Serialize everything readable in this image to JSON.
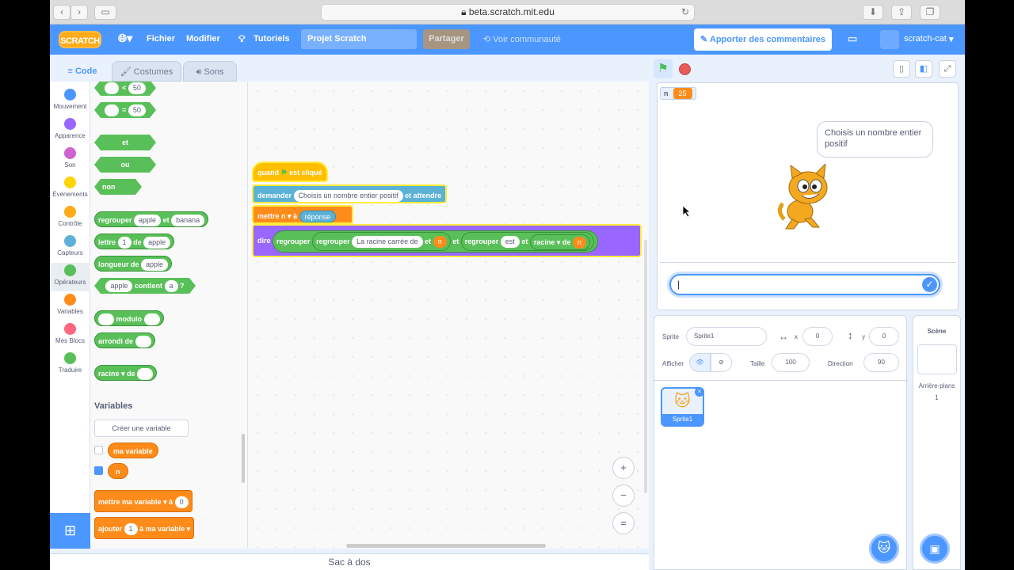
{
  "browser": {
    "url": "beta.scratch.mit.edu",
    "back": "‹",
    "forward": "›"
  },
  "menu": {
    "logo": "SCRATCH",
    "file": "Fichier",
    "edit": "Modifier",
    "tutorials": "Tutoriels",
    "project_title": "Projet Scratch",
    "share": "Partager",
    "see_community": "Voir communauté",
    "comments": "Apporter des commentaires",
    "username": "scratch-cat"
  },
  "tabs": {
    "code": "Code",
    "costumes": "Costumes",
    "sounds": "Sons"
  },
  "categories": [
    {
      "label": "Mouvement",
      "color": "#4c97ff"
    },
    {
      "label": "Apparence",
      "color": "#9966ff"
    },
    {
      "label": "Son",
      "color": "#cf63cf"
    },
    {
      "label": "Événements",
      "color": "#ffd500"
    },
    {
      "label": "Contrôle",
      "color": "#ffab19"
    },
    {
      "label": "Capteurs",
      "color": "#5cb1d6"
    },
    {
      "label": "Opérateurs",
      "color": "#59c059"
    },
    {
      "label": "Variables",
      "color": "#ff8c1a"
    },
    {
      "label": "Mes Blocs",
      "color": "#ff6680"
    },
    {
      "label": "Traduire",
      "color": "#59c059"
    }
  ],
  "palette": {
    "lt": "<",
    "lt_val": "50",
    "eq": "=",
    "eq_val": "50",
    "and": "et",
    "or": "ou",
    "not": "non",
    "join": "regrouper",
    "join_a": "apple",
    "join_b": "banana",
    "join_et": "et",
    "letter": "lettre",
    "letter_n": "1",
    "letter_de": "de",
    "letter_word": "apple",
    "length": "longueur de",
    "length_word": "apple",
    "contains_word": "apple",
    "contains": "contient",
    "contains_a": "a",
    "contains_q": "?",
    "mod": "modulo",
    "round": "arrondi de",
    "sqrt": "racine ▾",
    "sqrt_de": "de",
    "variables_title": "Variables",
    "create_var": "Créer une variable",
    "var1": "ma variable",
    "var2": "n",
    "set": "mettre",
    "set_var": "ma variable ▾",
    "set_a": "à",
    "set_val": "0",
    "change": "ajouter",
    "change_val": "1",
    "change_a": "à",
    "change_var": "ma variable ▾"
  },
  "script": {
    "hat_when": "quand",
    "hat_clicked": "est cliqué",
    "ask": "demander",
    "ask_text": "Choisis un nombre entier positif",
    "ask_wait": "et attendre",
    "set": "mettre",
    "set_var": "n ▾",
    "set_a": "à",
    "answer": "réponse",
    "say": "dire",
    "join1": "regrouper",
    "join2": "regrouper",
    "text1": "La racine carrée de",
    "et1": "et",
    "n1": "n",
    "et2": "et",
    "join3": "regrouper",
    "text2": "est",
    "et3": "et",
    "sqrt": "racine ▾",
    "de": "de",
    "n2": "n"
  },
  "zoom": {
    "in": "+",
    "out": "−",
    "reset": "="
  },
  "backpack": "Sac à dos",
  "stage": {
    "monitor_name": "n",
    "monitor_value": "25",
    "bubble": "Choisis un nombre entier positif"
  },
  "sprite_info": {
    "sprite_label": "Sprite",
    "sprite_name": "Sprite1",
    "x_label": "x",
    "x": "0",
    "y_label": "y",
    "y": "0",
    "show_label": "Afficher",
    "size_label": "Taille",
    "size": "100",
    "dir_label": "Direction",
    "dir": "90"
  },
  "sprites": [
    {
      "name": "Sprite1"
    }
  ],
  "scene": {
    "title": "Scène",
    "backdrops_label": "Arrière-plans",
    "backdrops_count": "1"
  }
}
